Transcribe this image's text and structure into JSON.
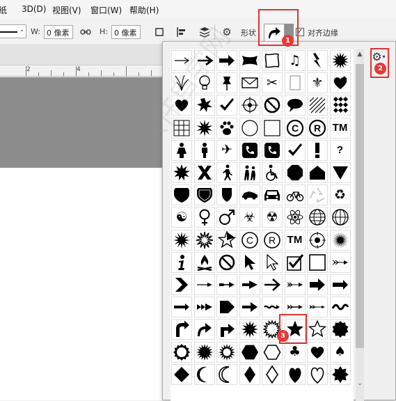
{
  "menubar": {
    "items": [
      "纸",
      "3D(D)",
      "视图(V)",
      "窗口(W)",
      "帮助(H)"
    ]
  },
  "options": {
    "width_label": "W:",
    "width_value": "0 像素",
    "height_label": "H:",
    "height_value": "0 像素",
    "shape_label": "形状",
    "align_edges_label": "对齐边缘",
    "align_edges_checked": "✓"
  },
  "ruler": {
    "marks": [
      "2",
      "4"
    ]
  },
  "badges": {
    "one": "1",
    "two": "2",
    "three": "3"
  },
  "watermark": "软件自学网",
  "colors": {
    "highlight": "#e03232",
    "badge": "#e53935",
    "pasteboard": "#8d8d8d"
  },
  "shapes": [
    "arrow-thin-icon",
    "arrow-medium-icon",
    "arrow-heavy-icon",
    "banner-icon",
    "frame-icon",
    "music-notes-icon",
    "lightning-icon",
    "starburst-icon",
    "grass-icon",
    "lightbulb-icon",
    "pushpin-icon",
    "envelope-icon",
    "scissors-icon",
    "blank-tile-icon",
    "fleur-de-lis-icon",
    "heart-leaf-icon",
    "heart-icon",
    "splat-icon",
    "checkmark-icon",
    "crosshair-icon",
    "no-sign-icon",
    "speech-bubble-icon",
    "diagonal-grid-icon",
    "diamond-grid-icon",
    "grid-icon",
    "burst-icon",
    "paw-icon",
    "circle-icon",
    "square-icon",
    "copyright-icon",
    "registered-icon",
    "trademark-icon",
    "woman-icon",
    "man-icon",
    "airplane-icon",
    "phone-icon",
    "phone-box-icon",
    "check-thin-icon",
    "exclamation-icon",
    "question-icon",
    "explosion-icon",
    "x-mark-icon",
    "pedestrian-icon",
    "school-crossing-icon",
    "wheelchair-icon",
    "octagon-icon",
    "house-icon",
    "triangle-down-icon",
    "shield-icon",
    "shield-outline-icon",
    "shield-small-icon",
    "car-side-icon",
    "car-front-icon",
    "bicycle-icon",
    "recycle-outline-icon",
    "recycle-icon",
    "yin-yang-icon",
    "female-icon",
    "male-icon",
    "biohazard-icon",
    "radiation-icon",
    "atom-icon",
    "globe-icon",
    "grid-globe-icon",
    "burst-black-icon",
    "burst-white-icon",
    "nautical-star-icon",
    "copyright-outline-icon",
    "registered-outline-icon",
    "tm-outline-icon",
    "target-icon",
    "sunburst-icon",
    "info-icon",
    "campfire-icon",
    "no-outline-icon",
    "pointer-icon",
    "pointer-outline-icon",
    "checkbox-icon",
    "box-icon",
    "feather-arrow-icon",
    "chevron-icon",
    "arrow-tail-icon",
    "arrow-double-tail-icon",
    "arrow-wide-icon",
    "arrow-outline-icon",
    "arrow-fletched-icon",
    "arrow-block-icon",
    "arrow-point-icon",
    "arrow-line-icon",
    "arrow-bold-tail-icon",
    "pentagon-arrow-icon",
    "arrow-bold-icon",
    "wavy-arrow-icon",
    "dash-arrow-icon",
    "dash-arrow-2-icon",
    "wave-icon",
    "curved-arrow-u-icon",
    "curved-arrow-icon",
    "turn-arrow-icon",
    "starburst-8-icon",
    "seal-icon",
    "star-icon",
    "star-outline-icon",
    "scallop-icon",
    "scallop-outline-icon",
    "burst-12-icon",
    "burst-outline-icon",
    "hexagon-icon",
    "hexagon-outline-icon",
    "club-icon",
    "heart-solid-icon",
    "spade-icon",
    "diamond-icon",
    "moon-icon",
    "moon-outline-icon",
    "diamond-tall-icon",
    "diamond-outline-icon",
    "heart-tall-icon",
    "heart-outline-icon",
    "flower-icon"
  ]
}
